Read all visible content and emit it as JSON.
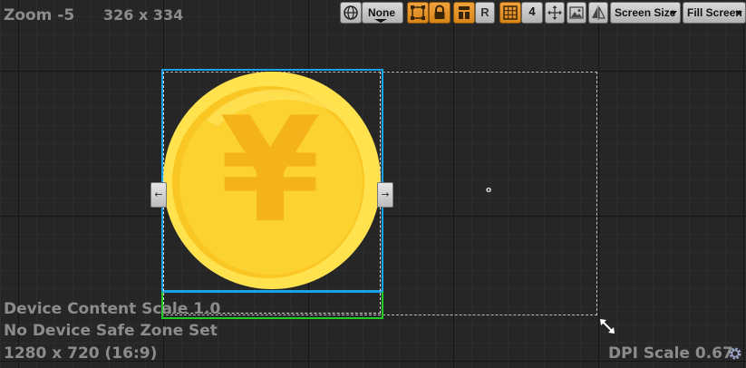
{
  "viewport": {
    "zoom_label": "Zoom -5",
    "widget_size": "326 x 334",
    "device_content_scale": "Device Content Scale 1.0",
    "safe_zone": "No Device Safe Zone Set",
    "resolution": "1280 x 720 (16:9)",
    "dpi_scale": "DPI Scale 0.67"
  },
  "toolbar": {
    "globe_dropdown_label": "None",
    "respect_locks_letter": "R",
    "grid_snap_value": "4",
    "screen_size_label": "Screen Size",
    "fill_screen_label": "Fill Screen"
  },
  "canvas": {
    "coin_symbol": "¥",
    "small_marker": "o",
    "left_handle_glyph": "←",
    "right_handle_glyph": "→"
  },
  "colors": {
    "selection_blue": "#1aa3e8",
    "safe_zone_green": "#22cc22",
    "coin_outer": "#ffe24d",
    "coin_inner": "#fcd02a",
    "coin_symbol": "#f4b21b",
    "toolbar_orange": "#e8952b"
  },
  "icons": [
    "globe-icon",
    "transform-icon",
    "lock-icon",
    "layout-icon",
    "grid-icon",
    "move-icon",
    "image-icon",
    "mirror-icon",
    "resize-handle-icon",
    "settings-gear-icon"
  ]
}
